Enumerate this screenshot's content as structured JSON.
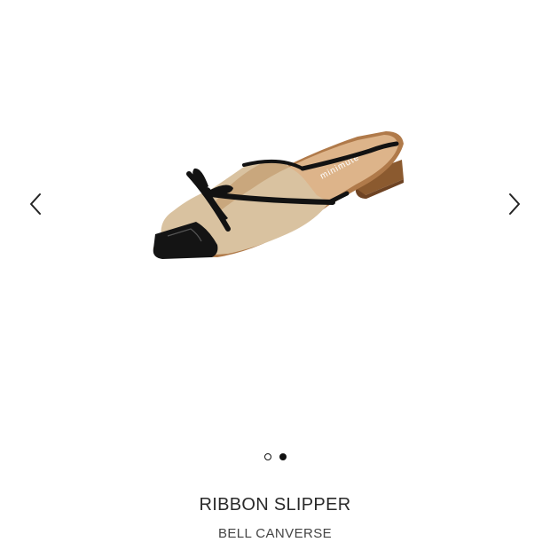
{
  "carousel": {
    "prev_icon": "chevron-left-icon",
    "next_icon": "chevron-right-icon",
    "image_alt": "RIBBON SLIPPER",
    "insole_print": "minimute",
    "slide_count": 2,
    "active_slide": 2
  },
  "product": {
    "title": "RIBBON SLIPPER",
    "brand": "BELL CANVERSE"
  },
  "colors": {
    "upper": "#d9c2a0",
    "strap": "#121212",
    "insole": "#ddb48a",
    "heel": "#8b5a2f"
  }
}
